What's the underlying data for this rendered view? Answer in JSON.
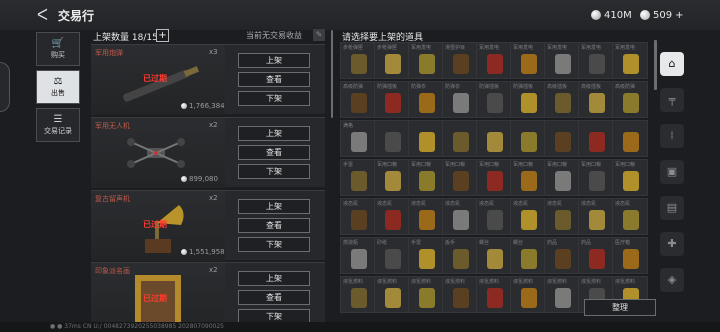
{
  "header": {
    "title": "交易行",
    "currency1": "410M",
    "currency2": "509",
    "plus": "+"
  },
  "nav": [
    {
      "label": "购买",
      "icon": "cart-icon",
      "glyph": "🛒"
    },
    {
      "label": "出售",
      "icon": "sell-icon",
      "glyph": "⚖"
    },
    {
      "label": "交易记录",
      "icon": "record-icon",
      "glyph": "☰"
    }
  ],
  "left": {
    "count_label": "上架数量 18/15",
    "plus": "+",
    "no_income": "当前无交易收益",
    "cards": [
      {
        "name": "军用炮弹",
        "qty": "x3",
        "status": "已过期",
        "price": "1,766,384",
        "list_btn": "上架",
        "view_btn": "查看",
        "remove_btn": "下架"
      },
      {
        "name": "军用无人机",
        "qty": "x2",
        "status": "",
        "price": "899,080",
        "list_btn": "上架",
        "view_btn": "查看",
        "remove_btn": "下架"
      },
      {
        "name": "复古留声机",
        "qty": "x2",
        "status": "已过期",
        "price": "1,551,958",
        "list_btn": "上架",
        "view_btn": "查看",
        "remove_btn": "下架"
      },
      {
        "name": "印象派名画",
        "qty": "x2",
        "status": "已过期",
        "price": "",
        "list_btn": "上架",
        "view_btn": "查看",
        "remove_btn": "下架"
      }
    ]
  },
  "right": {
    "title": "请选择要上架的道具",
    "sort_btn": "整理"
  },
  "grid": [
    [
      "步枪弹匣",
      "步枪弹匣",
      "军用发电",
      "滑雪护目",
      "军用发电",
      "军用发电",
      "军用发电",
      "军用发电",
      "军用发电"
    ],
    [
      "高级防弹",
      "防弹插板",
      "防弹衣",
      "防弹衣",
      "防弹插板",
      "防弹插板",
      "高级插板",
      "高级插板",
      "高级防弹"
    ],
    [
      "满格",
      "",
      "",
      "",
      "",
      "",
      "",
      "",
      ""
    ],
    [
      "手雷",
      "军用口粮",
      "军用口粮",
      "军用口粮",
      "军用口粮",
      "军用口粮",
      "军用口粮",
      "军用口粮",
      "军用口粮"
    ],
    [
      "液态氮",
      "液态氮",
      "液态氮",
      "液态氮",
      "液态氮",
      "液态氮",
      "液态氮",
      "液态氮",
      "液态氮"
    ],
    [
      "燃烧瓶",
      "砂纸",
      "手雷",
      "扳手",
      "螺丝",
      "螺丝",
      "药品",
      "药品",
      "医疗箱"
    ],
    [
      "液氢燃料",
      "液氢燃料",
      "液氢燃料",
      "液氢燃料",
      "液氢燃料",
      "液氢燃料",
      "液氢燃料",
      "液氢燃料",
      "液氢燃料"
    ]
  ],
  "status_bar": "●  ●  37ms    CN   U:/ 0048273920255038985 202807090025"
}
